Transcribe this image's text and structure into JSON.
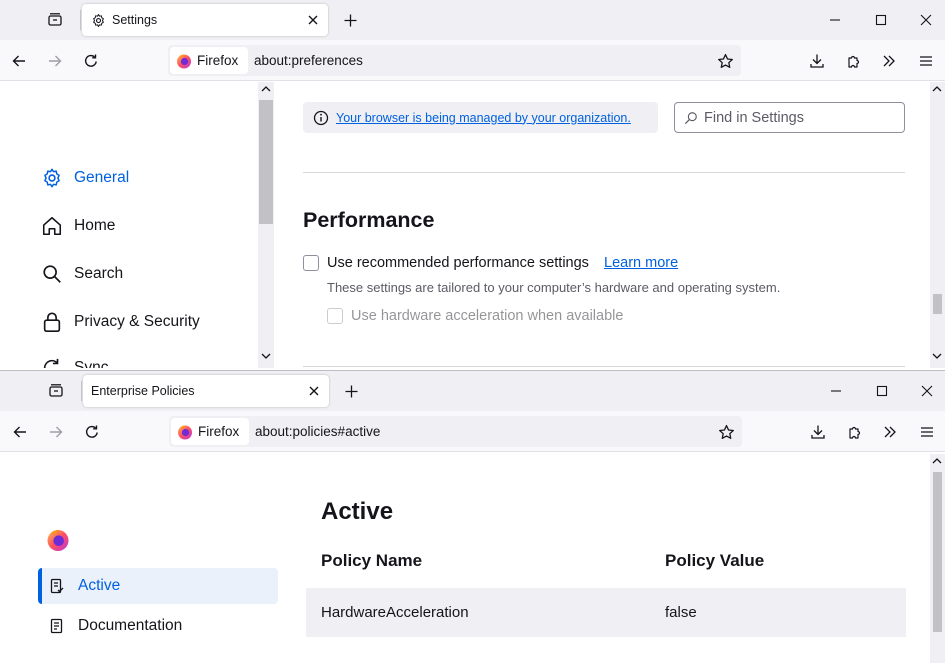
{
  "window_top": {
    "tab": {
      "title": "Settings",
      "icon": "gear-icon"
    },
    "urlbar": {
      "identity_label": "Firefox",
      "url": "about:preferences"
    },
    "sidebar": {
      "items": [
        {
          "label": "General",
          "icon": "gear-icon",
          "selected": true
        },
        {
          "label": "Home",
          "icon": "home-icon",
          "selected": false
        },
        {
          "label": "Search",
          "icon": "search-icon",
          "selected": false
        },
        {
          "label": "Privacy & Security",
          "icon": "lock-icon",
          "selected": false
        },
        {
          "label": "Sync",
          "icon": "sync-icon",
          "selected": false
        }
      ]
    },
    "notice": {
      "text": "Your browser is being managed by your organization."
    },
    "search": {
      "placeholder": "Find in Settings"
    },
    "performance": {
      "heading": "Performance",
      "recommended_label": "Use recommended performance settings",
      "learn_more": "Learn more",
      "description": "These settings are tailored to your computer’s hardware and operating system.",
      "hw_accel_label": "Use hardware acceleration when available",
      "recommended_checked": false,
      "hw_accel_checked": false
    }
  },
  "window_bottom": {
    "tab": {
      "title": "Enterprise Policies"
    },
    "urlbar": {
      "identity_label": "Firefox",
      "url": "about:policies#active"
    },
    "nav": [
      {
        "label": "Active",
        "icon": "policy-icon",
        "selected": true
      },
      {
        "label": "Documentation",
        "icon": "book-icon",
        "selected": false
      }
    ],
    "heading": "Active",
    "table": {
      "headers": [
        "Policy Name",
        "Policy Value"
      ],
      "rows": [
        {
          "name": "HardwareAcceleration",
          "value": "false"
        }
      ]
    }
  },
  "colors": {
    "accent": "#0061e0",
    "tabstrip": "#f0f0f4",
    "toolbar": "#f9f9fb",
    "text": "#15141a"
  }
}
